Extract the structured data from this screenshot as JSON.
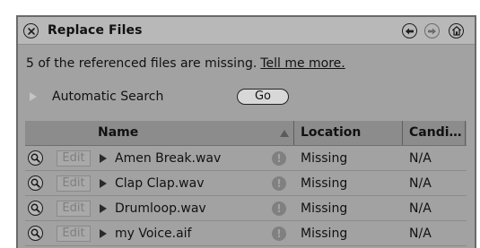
{
  "window": {
    "title": "Replace Files"
  },
  "message": {
    "text": "5 of the referenced files are missing.",
    "link": "Tell me more."
  },
  "auto_search": {
    "label": "Automatic Search",
    "go_label": "Go"
  },
  "table": {
    "columns": {
      "name": "Name",
      "location": "Location",
      "candidates": "Candi…"
    },
    "edit_label": "Edit",
    "rows": [
      {
        "name": "Amen Break.wav",
        "location": "Missing",
        "candidates": "N/A"
      },
      {
        "name": "Clap Clap.wav",
        "location": "Missing",
        "candidates": "N/A"
      },
      {
        "name": "Drumloop.wav",
        "location": "Missing",
        "candidates": "N/A"
      },
      {
        "name": "my Voice.aif",
        "location": "Missing",
        "candidates": "N/A"
      }
    ]
  },
  "icons": {
    "close": "close-icon",
    "back": "back-arrow-icon",
    "forward": "forward-arrow-icon",
    "home": "home-icon",
    "magnifier": "magnifier-icon",
    "warning": "warning-icon"
  },
  "colors": {
    "panel": "#a2a2a2",
    "titlebar": "#b8b8b8",
    "header": "#8c8c8c",
    "text": "#111111"
  }
}
